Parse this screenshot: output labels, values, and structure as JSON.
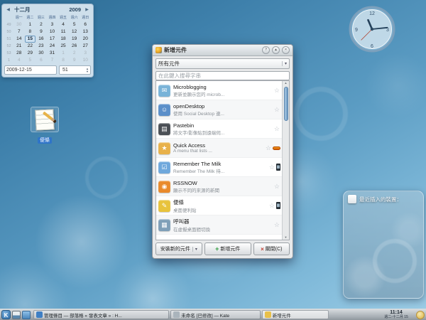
{
  "icons": {
    "prev": "◀",
    "next": "▶",
    "combo_chevron": "▾",
    "spin_up": "▲",
    "spin_down": "▼",
    "scroll_up": "▲",
    "scroll_down": "▼",
    "star_outline": "☆",
    "add_plus": "+",
    "close_x": "×",
    "help": "?",
    "shade": "▴"
  },
  "calendar": {
    "month": "十二月",
    "year": "2009",
    "day_headers": [
      "週一",
      "週二",
      "週三",
      "週四",
      "週五",
      "週六",
      "週日"
    ],
    "weeks": [
      {
        "num": "49",
        "days": [
          "30",
          "1",
          "2",
          "3",
          "4",
          "5",
          "6"
        ],
        "muted": [
          1,
          0,
          0,
          0,
          0,
          0,
          0
        ]
      },
      {
        "num": "50",
        "days": [
          "7",
          "8",
          "9",
          "10",
          "11",
          "12",
          "13"
        ],
        "muted": [
          0,
          0,
          0,
          0,
          0,
          0,
          0
        ]
      },
      {
        "num": "51",
        "days": [
          "14",
          "15",
          "16",
          "17",
          "18",
          "19",
          "20"
        ],
        "muted": [
          0,
          0,
          0,
          0,
          0,
          0,
          0
        ]
      },
      {
        "num": "52",
        "days": [
          "21",
          "22",
          "23",
          "24",
          "25",
          "26",
          "27"
        ],
        "muted": [
          0,
          0,
          0,
          0,
          0,
          0,
          0
        ]
      },
      {
        "num": "53",
        "days": [
          "28",
          "29",
          "30",
          "31",
          "1",
          "2",
          "3"
        ],
        "muted": [
          0,
          0,
          0,
          0,
          1,
          1,
          1
        ]
      },
      {
        "num": "1",
        "days": [
          "4",
          "5",
          "6",
          "7",
          "8",
          "9",
          "10"
        ],
        "muted": [
          1,
          1,
          1,
          1,
          1,
          1,
          1
        ]
      }
    ],
    "selected_day": "15",
    "date_value": "2009-12-15",
    "week_value": "51"
  },
  "clock": {
    "time": "11:14",
    "numbers": [
      "12",
      "3",
      "6",
      "9"
    ]
  },
  "widget_dialog": {
    "title": "新增元件",
    "category_filter": "所有元件",
    "search_placeholder": "在此鍵入搜尋字串",
    "items": [
      {
        "title": "Microblogging",
        "subtitle": "更新並顯示您的 microb...",
        "icon": "microblogging-icon",
        "glyph": "✉",
        "color": "#79b3d8",
        "badge": null
      },
      {
        "title": "openDesktop",
        "subtitle": "使用 Social Desktop 連...",
        "icon": "opendesktop-icon",
        "glyph": "☺",
        "color": "#5b8fc9",
        "badge": null
      },
      {
        "title": "Pastebin",
        "subtitle": "將文字/影像貼到遠端伺...",
        "icon": "pastebin-icon",
        "glyph": "▤",
        "color": "#4a4f55",
        "badge": null
      },
      {
        "title": "Quick Access",
        "subtitle": "A menu that lists ...",
        "icon": "quick-access-icon",
        "glyph": "★",
        "color": "#e8b14a",
        "badge": "running"
      },
      {
        "title": "Remember The Milk",
        "subtitle": "Remember The Milk 待...",
        "icon": "remember-the-milk-icon",
        "glyph": "☑",
        "color": "#6fa8dc",
        "badge": "phone"
      },
      {
        "title": "RSSNOW",
        "subtitle": "顯示不同的來源的新聞",
        "icon": "rssnow-icon",
        "glyph": "◉",
        "color": "#e98a2b",
        "badge": null
      },
      {
        "title": "便條",
        "subtitle": "桌面便利貼",
        "icon": "notes-icon",
        "glyph": "✎",
        "color": "#e8c33c",
        "badge": "phone"
      },
      {
        "title": "呼叫器",
        "subtitle": "在虛擬桌面間切換",
        "icon": "pager-icon",
        "glyph": "▦",
        "color": "#7f9fb8",
        "badge": null
      }
    ],
    "buttons": {
      "install": "安裝新的元件",
      "add": "新增元件",
      "close": "關閉(C)"
    }
  },
  "device_notifier": {
    "title": "最近插入的裝置："
  },
  "desktop_icon": {
    "label": "便條"
  },
  "taskbar": {
    "kmenu_label": "K",
    "tasks": [
      {
        "title": "管理條目 — 部落格 « 發表文章 » : H...",
        "icon_name": "browser-task-icon",
        "icon_color": "#3f7fc4"
      },
      {
        "title": "未命名 [已修改] — Kate",
        "icon_name": "kate-task-icon",
        "icon_color": "#aab4bc"
      },
      {
        "title": "新增元件",
        "icon_name": "plasma-task-icon",
        "icon_color": "#e8c04a"
      }
    ],
    "tray": [
      {
        "name": "klipper-icon",
        "glyph": "▤",
        "color": "#eef2f5"
      },
      {
        "name": "im-status-icon",
        "glyph": "●",
        "color": "#4f90c8"
      },
      {
        "name": "volume-icon",
        "glyph": "◀",
        "color": "#39434c"
      },
      {
        "name": "network-icon",
        "glyph": "◆",
        "color": "#79b450"
      },
      {
        "name": "battery-icon",
        "glyph": "▮",
        "color": "#dde2e6"
      }
    ],
    "clock": {
      "time": "11:14",
      "date": "週二-十二月 15"
    }
  }
}
